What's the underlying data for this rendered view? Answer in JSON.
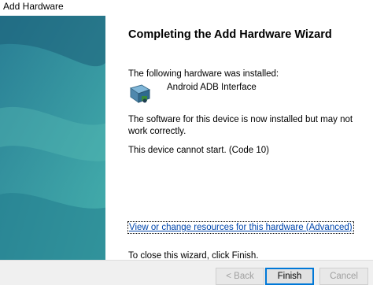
{
  "window": {
    "title": "Add Hardware"
  },
  "main": {
    "heading": "Completing the Add Hardware Wizard",
    "installed_label": "The following hardware was installed:",
    "device_name": "Android ADB Interface",
    "device_icon": "hardware-device-icon",
    "warning_text": "The software for this device is now installed but may not work correctly.",
    "status_text": "This device cannot start. (Code 10)",
    "resources_link": "View or change resources for this hardware (Advanced)",
    "close_instruction": "To close this wizard, click Finish."
  },
  "buttons": {
    "back_label": "< Back",
    "finish_label": "Finish",
    "cancel_label": "Cancel"
  }
}
